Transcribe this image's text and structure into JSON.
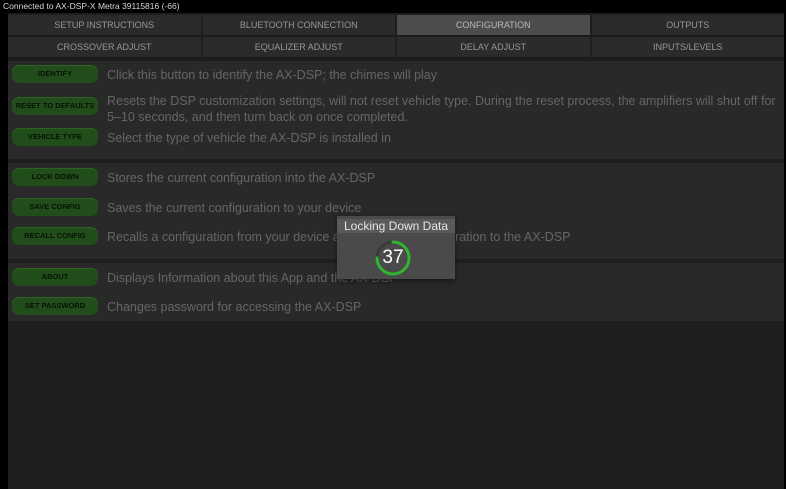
{
  "status": {
    "connection": "Connected to AX-DSP-X Metra 39115816 (-66)"
  },
  "tabs_row1": [
    {
      "label": "SETUP INSTRUCTIONS",
      "active": false
    },
    {
      "label": "BLUETOOTH CONNECTION",
      "active": false
    },
    {
      "label": "CONFIGURATION",
      "active": true
    },
    {
      "label": "OUTPUTS",
      "active": false
    }
  ],
  "tabs_row2": [
    {
      "label": "CROSSOVER ADJUST"
    },
    {
      "label": "EQUALIZER ADJUST"
    },
    {
      "label": "DELAY ADJUST"
    },
    {
      "label": "INPUTS/LEVELS"
    }
  ],
  "actions": {
    "identify": {
      "label": "IDENTIFY",
      "desc": "Click this button to identify the AX-DSP; the chimes will play"
    },
    "reset": {
      "label": "RESET TO DEFAULTS",
      "desc": "Resets the DSP customization settings, will not reset vehicle type. During the reset process, the amplifiers will shut off for 5–10 seconds, and then turn back on once completed."
    },
    "vehicle": {
      "label": "VEHICLE TYPE",
      "desc": "Select the type of vehicle the AX-DSP is installed in"
    },
    "lockdown": {
      "label": "LOCK DOWN",
      "desc": "Stores the current configuration into the AX-DSP"
    },
    "save": {
      "label": "SAVE CONFIG",
      "desc": "Saves the current configuration to your device"
    },
    "recall": {
      "label": "RECALL CONFIG",
      "desc": "Recalls a configuration from your device and sends the configuration to the AX-DSP"
    },
    "about": {
      "label": "ABOUT",
      "desc": "Displays Information about this App and the AX-DSP"
    },
    "password": {
      "label": "SET PASSWORD",
      "desc": "Changes password for accessing the AX-DSP"
    }
  },
  "dialog": {
    "title": "Locking Down Data",
    "progress_value": "37",
    "progress_fraction": 0.37,
    "accent": "#2fb52f"
  },
  "colors": {
    "button_green": "#2f6b24",
    "active_tab": "#6a6a6a"
  }
}
